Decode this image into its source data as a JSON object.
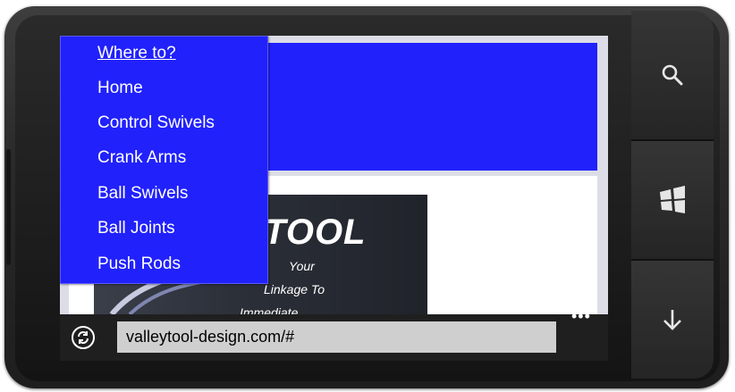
{
  "menu": {
    "title": "Where to?",
    "items": [
      "Home",
      "Control Swivels",
      "Crank Arms",
      "Ball Swivels",
      "Ball Joints",
      "Push Rods"
    ]
  },
  "logo": {
    "brand": "/TOOL",
    "tagline_1": "Your",
    "tagline_2": "Linkage To",
    "tagline_3": "Immediate"
  },
  "address_bar": {
    "url": "valleytool-design.com/#",
    "more_label": "•••"
  },
  "hardware_buttons": {
    "search": "search-icon",
    "start": "windows-icon",
    "back": "down-arrow-icon"
  },
  "colors": {
    "header_blue": "#2121fc",
    "menu_blue": "#2121fc",
    "address_bar_bg": "#1f1f1f",
    "url_field_bg": "#cfcfcf"
  }
}
